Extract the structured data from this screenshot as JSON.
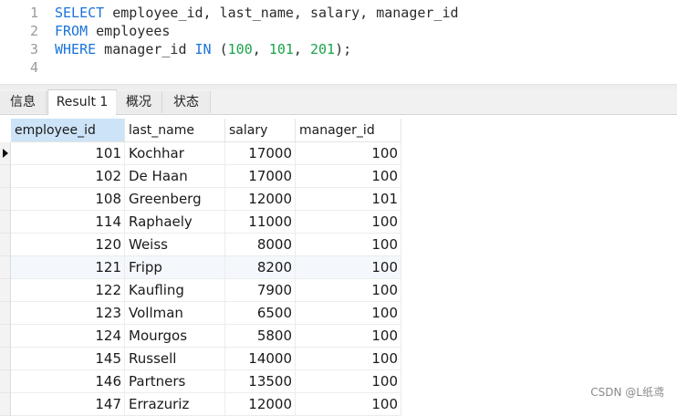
{
  "editor": {
    "lines": [
      {
        "num": "1",
        "tokens": [
          [
            "kw",
            "SELECT"
          ],
          [
            "t",
            " employee_id, last_name, salary, manager_id"
          ]
        ]
      },
      {
        "num": "2",
        "tokens": [
          [
            "kw",
            "FROM"
          ],
          [
            "t",
            " employees"
          ]
        ]
      },
      {
        "num": "3",
        "tokens": [
          [
            "kw",
            "WHERE"
          ],
          [
            "t",
            " manager_id "
          ],
          [
            "kw",
            "IN"
          ],
          [
            "t",
            " ("
          ],
          [
            "num",
            "100"
          ],
          [
            "t",
            ", "
          ],
          [
            "num",
            "101"
          ],
          [
            "t",
            ", "
          ],
          [
            "num",
            "201"
          ],
          [
            "t",
            ");"
          ]
        ]
      },
      {
        "num": "4",
        "tokens": []
      }
    ]
  },
  "tabs": [
    {
      "label": "信息",
      "active": false
    },
    {
      "label": "Result 1",
      "active": true
    },
    {
      "label": "概况",
      "active": false
    },
    {
      "label": "状态",
      "active": false
    }
  ],
  "grid": {
    "columns": [
      "employee_id",
      "last_name",
      "salary",
      "manager_id"
    ],
    "selected_column": "employee_id",
    "current_row": 0,
    "rows": [
      [
        "101",
        "Kochhar",
        "17000",
        "100"
      ],
      [
        "102",
        "De Haan",
        "17000",
        "100"
      ],
      [
        "108",
        "Greenberg",
        "12000",
        "101"
      ],
      [
        "114",
        "Raphaely",
        "11000",
        "100"
      ],
      [
        "120",
        "Weiss",
        "8000",
        "100"
      ],
      [
        "121",
        "Fripp",
        "8200",
        "100"
      ],
      [
        "122",
        "Kaufling",
        "7900",
        "100"
      ],
      [
        "123",
        "Vollman",
        "6500",
        "100"
      ],
      [
        "124",
        "Mourgos",
        "5800",
        "100"
      ],
      [
        "145",
        "Russell",
        "14000",
        "100"
      ],
      [
        "146",
        "Partners",
        "13500",
        "100"
      ],
      [
        "147",
        "Errazuriz",
        "12000",
        "100"
      ]
    ]
  },
  "watermark": "CSDN @L纸鸢"
}
